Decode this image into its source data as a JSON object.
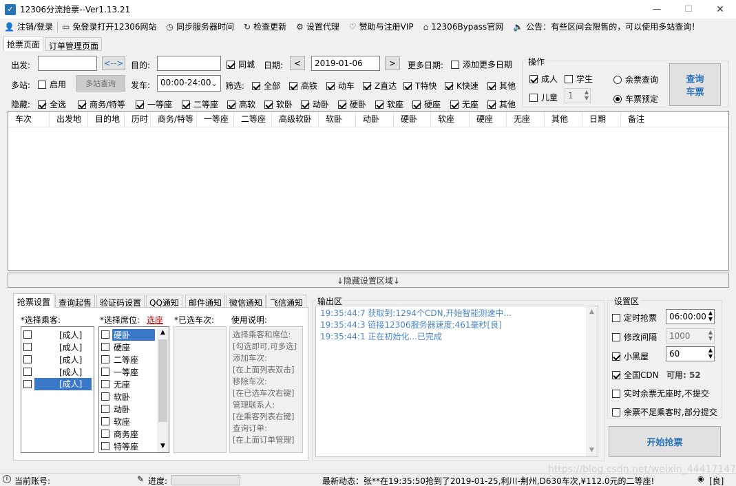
{
  "window": {
    "title": "12306分流抢票--Ver1.13.21",
    "controls": [
      "—",
      "☐",
      "✕"
    ]
  },
  "menu": [
    {
      "icon": "user-icon",
      "label": "注销/登录"
    },
    {
      "icon": "window-icon",
      "label": "免登录打开12306网站"
    },
    {
      "icon": "clock-icon",
      "label": "同步服务器时间"
    },
    {
      "icon": "refresh-icon",
      "label": "检查更新"
    },
    {
      "icon": "gear-icon",
      "label": "设置代理"
    },
    {
      "icon": "heart-icon",
      "label": "赞助与注册VIP"
    },
    {
      "icon": "home-icon",
      "label": "12306Bypass官网"
    },
    {
      "icon": "speaker-icon",
      "label": "公告：有些区间会限售的，可以使用多站查询！"
    }
  ],
  "tabs": [
    "抢票页面",
    "订单管理页面"
  ],
  "query": {
    "from_label": "出发:",
    "from_value": "",
    "swap_label": "<-->",
    "to_label": "目的:",
    "to_value": "",
    "samecity_label": "同城",
    "date_label": "日期:",
    "date_prev": "<",
    "date_value": "2019-01-06",
    "date_next": ">",
    "more_dates_label": "更多日期:",
    "add_dates_label": "添加更多日期",
    "multistation_label": "多站:",
    "enable_label": "启用",
    "multi_query_btn": "多站查询",
    "depart_label": "发车:",
    "depart_value": "00:00-24:00",
    "filter_label": "筛选:",
    "filters": [
      "全部",
      "高铁",
      "动车",
      "Z直达",
      "T特快",
      "K快速",
      "其他"
    ],
    "hide_label": "隐藏:",
    "hides": [
      "全选",
      "商务/特等",
      "一等座",
      "二等座",
      "高软",
      "软卧",
      "动卧",
      "硬卧",
      "软座",
      "硬座",
      "无座",
      "其他"
    ]
  },
  "ops": {
    "title": "操作",
    "adult": "成人",
    "student": "学生",
    "child": "儿童",
    "child_count": "1",
    "radio_remaining": "余票查询",
    "radio_reserve": "车票预定",
    "query_btn_line1": "查询",
    "query_btn_line2": "车票"
  },
  "table": {
    "columns": [
      "车次",
      "出发地",
      "目的地",
      "历时",
      "商务/特等",
      "一等座",
      "二等座",
      "高级软卧",
      "软卧",
      "动卧",
      "硬卧",
      "软座",
      "硬座",
      "无座",
      "其他",
      "日期",
      "备注"
    ]
  },
  "hide_bar": "↓隐藏设置区域↓",
  "settings_tabs": [
    "抢票设置",
    "查询起售",
    "验证码设置",
    "QQ通知",
    "邮件通知",
    "微信通知",
    "飞信通知"
  ],
  "passengers": {
    "label": "*选择乘客:",
    "items": [
      "[成人]",
      "[成人]",
      "[成人]",
      "[成人]",
      "[成人]"
    ]
  },
  "seats": {
    "label": "*选择席位:",
    "link": "选座",
    "items": [
      "硬卧",
      "硬座",
      "二等座",
      "一等座",
      "无座",
      "软卧",
      "动卧",
      "软座",
      "商务座",
      "特等座"
    ]
  },
  "trains": {
    "label": "*已选车次:"
  },
  "usage": {
    "label": "使用说明:",
    "lines": [
      "选择乘客和席位:",
      "[勾选即可,可多选]",
      "添加车次:",
      "[在上面列表双击]",
      "移除车次:",
      "[在已选车次右键]",
      "管理联系人:",
      "[在乘客列表右键]",
      "查询订单:",
      "[在上面订单管理]"
    ]
  },
  "output": {
    "label": "输出区",
    "logs": [
      "19:35:44:7   获取到:1294个CDN,开始智能测速中...",
      "19:35:44:3   链接12306服务器速度:461毫秒[良]",
      "19:35:44:1   正在初始化...已完成"
    ]
  },
  "settings": {
    "label": "设置区",
    "timed": "定时抢票",
    "timed_value": "06:00:00",
    "interval": "修改间隔",
    "interval_value": "1000",
    "blackroom": "小黑屋",
    "blackroom_value": "60",
    "cdn": "全国CDN",
    "cdn_avail_label": "可用:",
    "cdn_avail": "52",
    "no_seat": "实时余票无座时,不提交",
    "partial": "余票不足乘客时,部分提交",
    "start_btn": "开始抢票"
  },
  "status": {
    "account_label": "当前账号:",
    "progress_label": "进度:",
    "news": "最新动态：张**在19:35:50抢到了2019-01-25,利川-荆州,D630车次,¥112.0元的二等座!",
    "signal": "[良]",
    "watermark": "https://blog.csdn.net/weixin_44417147"
  },
  "colors": {
    "accent": "#2b73b7",
    "link": "#c00000",
    "log": "#4a86c5"
  }
}
